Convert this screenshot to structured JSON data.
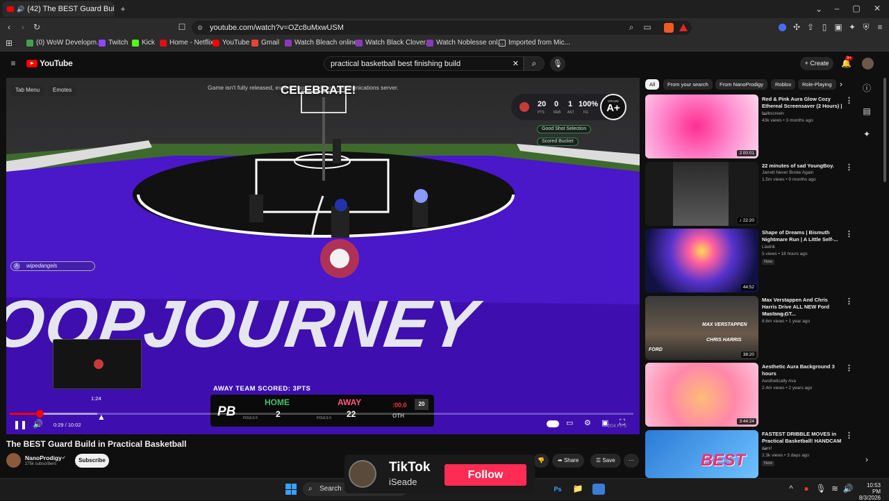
{
  "browser": {
    "tab_title": "(42) The BEST Guard Build in",
    "url": "youtube.com/watch?v=OZc8uMxwUSM",
    "bookmarks": [
      "(0) WoW Developm...",
      "Twitch",
      "Kick",
      "Home - Netflix",
      "YouTube",
      "Gmail",
      "Watch Bleach online...",
      "Watch Black Clover...",
      "Watch Noblesse onl...",
      "Imported from Mic..."
    ]
  },
  "youtube": {
    "logo": "YouTube",
    "search_query": "practical basketball best finishing build",
    "create_label": "Create",
    "notif_count": "9+"
  },
  "video": {
    "hud_tab_menu": "Tab Menu",
    "hud_emotes": "Emotes",
    "game_notice": "Game isn't fully released, expect bugs ... join our communications server.",
    "celebrate": "CELEBRATE!",
    "stats": {
      "pts": "20",
      "reb": "0",
      "ast": "1",
      "fg": "100%",
      "pts_l": "PTS",
      "reb_l": "REB",
      "ast_l": "AST",
      "fg_l": "FG",
      "grade_label": "GRADE",
      "grade": "A+"
    },
    "feedback": [
      "Good Shot Selection",
      "Scored Bucket"
    ],
    "player_tag": "wipedangels",
    "court_text": "OOPJOURNEY",
    "away_scored": "AWAY TEAM SCORED: 3PTS",
    "scoreboard": {
      "logo": "PB",
      "home_label": "HOME",
      "home_score": "2",
      "home_fouls": "FOULS 0",
      "away_label": "AWAY",
      "away_score": "22",
      "away_fouls": "FOULS 0",
      "clock": ":00.0",
      "shot_clock": "20",
      "period": "OTH"
    },
    "preview_time": "1:24",
    "time_display": "0:29 / 10:02",
    "progress": 0.048,
    "buffered": 0.14,
    "fps": "204 FPS"
  },
  "info": {
    "title": "The BEST Guard Build in Practical Basketball",
    "channel": "NanoProdigy",
    "subscribers": "275k subscribers",
    "subscribe": "Subscribe",
    "share": "Share",
    "save": "Save"
  },
  "chips": [
    "All",
    "From your search",
    "From NanoProdigy",
    "Roblox",
    "Role-Playing"
  ],
  "recommendations": [
    {
      "title": "Red & Pink Aura Glow Cozy Ethereal Screensaver (2 Hours) | ...",
      "channel": "bulbscreen",
      "meta": "43k views • 3 months ago",
      "duration": "2:00:01",
      "new": ""
    },
    {
      "title": "22 minutes of sad YoungBoy.",
      "channel": "Jarrett Never Broke Again",
      "meta": "1.5m views • 9 months ago",
      "duration": "22:20",
      "new": ""
    },
    {
      "title": "Shape of Dreams | Bismuth Nightmare Run | A Little Self-...",
      "channel": "Lladrik",
      "meta": "5 views • 18 hours ago",
      "duration": "44:52",
      "new": "New"
    },
    {
      "title": "Max Verstappen And Chris Harris Drive ALL NEW Ford Mustang GT...",
      "channel": "Ford Racing",
      "meta": "8.6m views • 1 year ago",
      "duration": "38:20",
      "new": "",
      "overlay1": "MAX VERSTAPPEN",
      "overlay2": "CHRIS HARRIS",
      "overlay3": "FORD"
    },
    {
      "title": "Aesthetic Aura Background 3 hours",
      "channel": "Aesthetically Ava",
      "meta": "2.4m views • 2 years ago",
      "duration": "3:44:24",
      "new": ""
    },
    {
      "title": "FASTEST DRIBBLE MOVES in Practical Basketball! HANDCAM ...",
      "channel": "darx!",
      "meta": "2.3k views • 3 days ago",
      "duration": "",
      "new": "New",
      "overlay1": "BEST"
    }
  ],
  "tiktok": {
    "brand": "TikTok",
    "user": "iSeade",
    "follow": "Follow"
  },
  "taskbar": {
    "search": "Search",
    "time": "10:53 PM",
    "date": "8/3/2026"
  },
  "colors": {
    "accent_red": "#ff0000",
    "court_purple": "#4a17c9",
    "follow_red": "#fe2c55",
    "green_hud": "#2f8a4a"
  }
}
